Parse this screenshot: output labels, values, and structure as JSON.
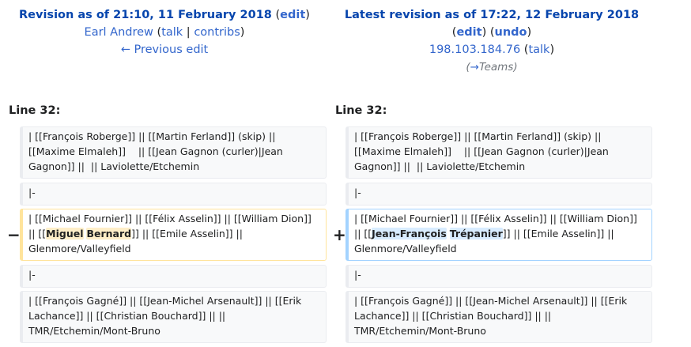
{
  "left_header": {
    "title": "Revision as of 21:10, 11 February 2018",
    "edit": "edit",
    "user": "Earl Andrew",
    "talk": "talk",
    "contribs": "contribs",
    "prev": "← Previous edit"
  },
  "right_header": {
    "title": "Latest revision as of 17:22, 12 February 2018",
    "edit": "edit",
    "undo": "undo",
    "user": "198.103.184.76",
    "talk": "talk",
    "summary_arrow": "→",
    "summary": "Teams"
  },
  "line_label_left": "Line 32:",
  "line_label_right": "Line 32:",
  "rows": {
    "r1": "| [[François Roberge]] || [[Martin Ferland]] (skip) || [[Maxime Elmaleh]]    || [[Jean Gagnon (curler)|Jean Gagnon]] ||  || Laviolette/Etchemin",
    "r2": "|-",
    "del_before": "| [[Michael Fournier]] || [[Félix Asselin]] || [[William Dion]] || [[",
    "del_w1": "Miguel",
    "del_w2": "Bernard",
    "del_after": "]] || [[Emile Asselin]] || Glenmore/Valleyfield",
    "add_before": "| [[Michael Fournier]] || [[Félix Asselin]] || [[William Dion]] || [[",
    "add_w1": "Jean-François",
    "add_w2": "Trépanier",
    "add_after": "]] || [[Emile Asselin]] || Glenmore/Valleyfield",
    "r4": "|-",
    "r5": "| [[François Gagné]] || [[Jean-Michel Arsenault]] || [[Erik Lachance]] || [[Christian Bouchard]] || || TMR/Etchemin/Mont-Bruno"
  },
  "markers": {
    "minus": "−",
    "plus": "+"
  }
}
